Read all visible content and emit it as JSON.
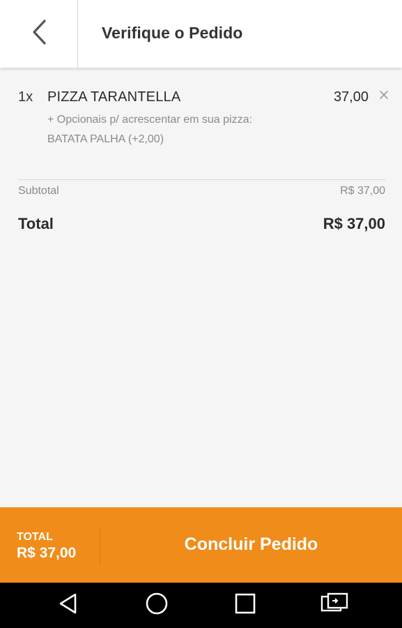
{
  "header": {
    "title": "Verifique o Pedido",
    "back_icon": "chevron-left-icon"
  },
  "order": {
    "items": [
      {
        "quantity": "1x",
        "name": "PIZZA TARANTELLA",
        "price": "37,00",
        "option_label": "+ Opcionais p/ acrescentar em sua pizza:",
        "option_value": "BATATA PALHA (+2,00)",
        "remove_icon": "close-icon"
      }
    ],
    "subtotal_label": "Subtotal",
    "subtotal_value": "R$ 37,00",
    "total_label": "Total",
    "total_value": "R$ 37,00"
  },
  "action_bar": {
    "total_label": "TOTAL",
    "total_value": "R$ 37,00",
    "confirm_label": "Concluir Pedido",
    "color": "#f08c1a"
  },
  "system_nav": {
    "icons": [
      "back-triangle-icon",
      "home-circle-icon",
      "recents-square-icon",
      "screen-switch-icon"
    ]
  }
}
